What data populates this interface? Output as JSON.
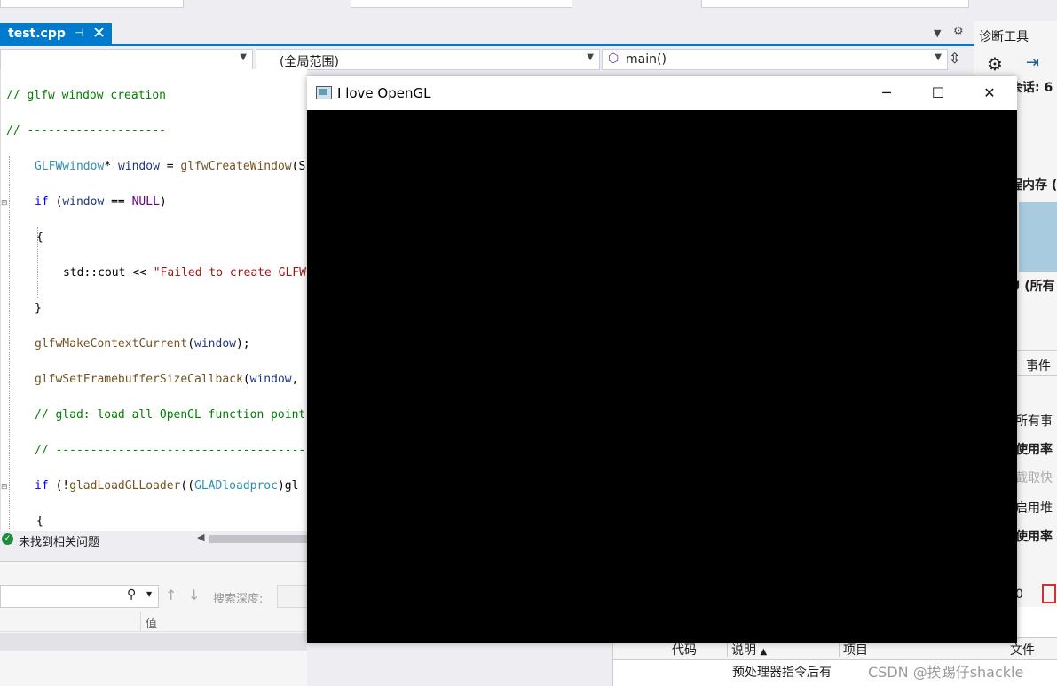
{
  "editor_tab": {
    "filename": "test.cpp",
    "pin_icon": "pin-icon",
    "close_glyph": "✕"
  },
  "nav": {
    "scope": "(全局范围)",
    "member": "main()"
  },
  "code": [
    [
      [
        "// glfw window creation",
        "c-cmt"
      ]
    ],
    [
      [
        "// --------------------",
        "c-cmt"
      ]
    ],
    [
      [
        "GLFWwindow",
        "c-type"
      ],
      [
        "* ",
        "c-pl"
      ],
      [
        "window",
        "c-id"
      ],
      [
        " = ",
        "c-pl"
      ],
      [
        "glfwCreateWindow",
        "c-fn"
      ],
      [
        "(S",
        "c-pl"
      ]
    ],
    [
      [
        "if",
        "c-kw"
      ],
      [
        " (",
        "c-pl"
      ],
      [
        "window",
        "c-id"
      ],
      [
        " == ",
        "c-pl"
      ],
      [
        "NULL",
        "c-mac"
      ],
      [
        ")",
        "c-pl"
      ]
    ],
    [
      [
        "{",
        "c-pl"
      ]
    ],
    [
      [
        "std",
        "c-pl"
      ],
      [
        "::",
        "c-pl"
      ],
      [
        "cout",
        "c-pl"
      ],
      [
        " << ",
        "c-pl"
      ],
      [
        "\"Failed to create GLFW",
        "c-str"
      ]
    ],
    [
      [
        "}",
        "c-pl"
      ]
    ],
    [
      [
        "glfwMakeContextCurrent",
        "c-fn"
      ],
      [
        "(",
        "c-pl"
      ],
      [
        "window",
        "c-id"
      ],
      [
        ");",
        "c-pl"
      ]
    ],
    [
      [
        "glfwSetFramebufferSizeCallback",
        "c-fn"
      ],
      [
        "(",
        "c-pl"
      ],
      [
        "window",
        "c-id"
      ],
      [
        ",",
        "c-pl"
      ]
    ],
    [
      [
        "// glad: load all OpenGL function point",
        "c-cmt"
      ]
    ],
    [
      [
        "// -------------------------------------",
        "c-cmt"
      ]
    ],
    [
      [
        "if",
        "c-kw"
      ],
      [
        " (!",
        "c-pl"
      ],
      [
        "gladLoadGLLoader",
        "c-fn"
      ],
      [
        "((",
        "c-pl"
      ],
      [
        "GLADloadproc",
        "c-type"
      ],
      [
        ")gl",
        "c-pl"
      ]
    ],
    [
      [
        "{",
        "c-pl"
      ]
    ]
  ],
  "status": {
    "issues": "未找到相关问题"
  },
  "lower": {
    "search_depth_label": "搜索深度:",
    "value_col": "值"
  },
  "diag": {
    "title": "诊断工具",
    "session": "会话: 6",
    "memory": "程内存 (",
    "cpu": "U (所有",
    "events_tab": "事件",
    "all_events": "所有事",
    "usage1": "使用率",
    "snapshot": "截取快",
    "heap": "启用堆",
    "usage2": "使用率",
    "count": "0"
  },
  "errlist": {
    "col_code": "代码",
    "col_desc": "说明",
    "col_project": "项目",
    "col_file": "文件",
    "row_desc": "预处理器指令后有"
  },
  "gl_window": {
    "title": "I love OpenGL",
    "min": "─",
    "max": "☐",
    "close": "✕"
  },
  "watermark": "CSDN @挨踢仔shackle"
}
